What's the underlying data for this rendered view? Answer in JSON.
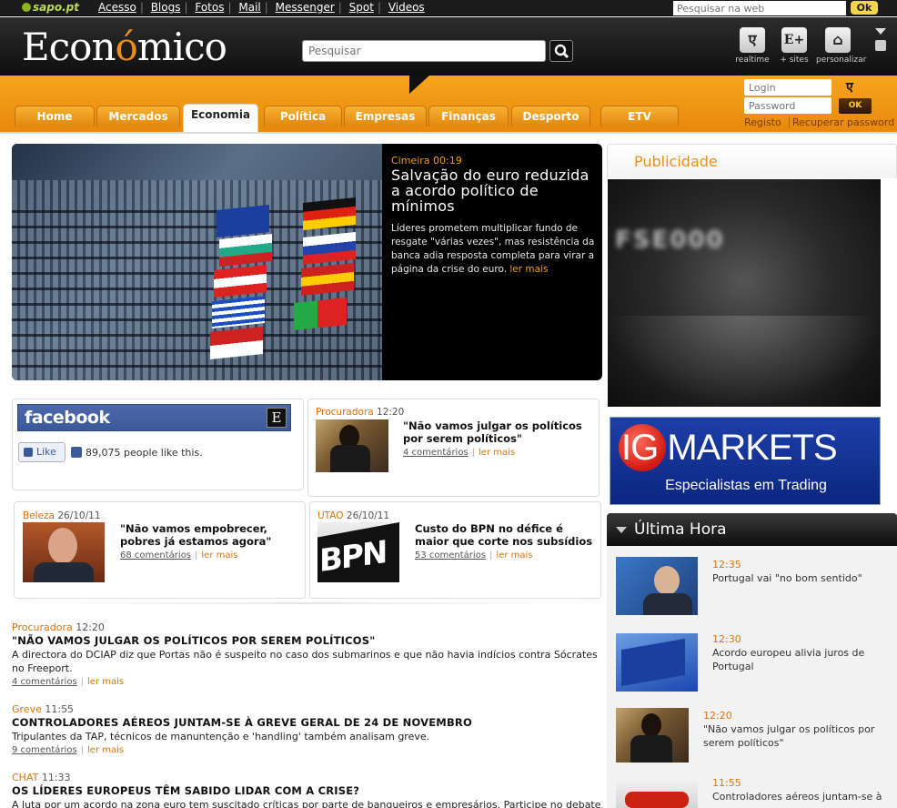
{
  "sapo": {
    "logo": "sapo.pt",
    "links": [
      "Acesso",
      "Blogs",
      "Fotos",
      "Mail",
      "Messenger",
      "Spot",
      "Videos"
    ],
    "search_placeholder": "Pesquisar na web",
    "ok_label": "Ok"
  },
  "header": {
    "logo_pre": "Econ",
    "logo_accent": "ó",
    "logo_post": "mico",
    "search_placeholder": "Pesquisar",
    "icons": [
      {
        "glyph": "ए",
        "label": "realtime"
      },
      {
        "glyph": "E+",
        "label": "+ sites"
      },
      {
        "glyph": "⌂",
        "label": "personalizar"
      }
    ]
  },
  "nav": {
    "tabs": [
      "Home",
      "Mercados",
      "Economia",
      "Política",
      "Empresas",
      "Finanças",
      "Desporto",
      "ETV"
    ],
    "active": "Economia"
  },
  "login": {
    "login_placeholder": "Login",
    "password_placeholder": "Password",
    "ok_label": "OK",
    "register": "Registo",
    "recover": "Recuperar password"
  },
  "hero": {
    "kicker": "Cimeira 00:19",
    "title": "Salvação do euro reduzida a acordo político de mínimos",
    "desc": "Líderes prometem multiplicar fundo de resgate \"várias vezes\", mas resistência da banca adia resposta completa para virar a página da crise do euro.",
    "more": "ler mais"
  },
  "facebook": {
    "brand": "facebook",
    "badge": "E",
    "like_label": "Like",
    "like_count": "89,075 people like this."
  },
  "cards": [
    {
      "section": "Procuradora",
      "time": "12:20",
      "title": "\"Não vamos julgar os políticos por serem políticos\"",
      "comments": "4 comentários",
      "more": "ler mais"
    },
    {
      "section": "Beleza",
      "time": "26/10/11",
      "title": "\"Não vamos empobrecer, pobres já estamos agora\"",
      "comments": "68 comentários",
      "more": "ler mais"
    },
    {
      "section": "UTAO",
      "time": "26/10/11",
      "title": "Custo do BPN no défice é maior que corte nos subsídios",
      "comments": "53 comentários",
      "more": "ler mais",
      "thumb_text": "BPN"
    }
  ],
  "articles": [
    {
      "section": "Procuradora",
      "time": "12:20",
      "title": "\"NÃO VAMOS JULGAR OS POLÍTICOS POR SEREM POLÍTICOS\"",
      "desc": "A directora do DCIAP diz que Portas não é suspeito no caso dos submarinos e que não havia indícios contra Sócrates no Freeport.",
      "comments": "4 comentários",
      "more": "ler mais"
    },
    {
      "section": "Greve",
      "time": "11:55",
      "title": "CONTROLADORES AÉREOS JUNTAM-SE À GREVE GERAL DE 24 DE NOVEMBRO",
      "desc": "Tripulantes da TAP, técnicos de manuntenção e 'handling' também analisam greve.",
      "comments": "9 comentários",
      "more": "ler mais"
    },
    {
      "section": "CHAT",
      "time": "11:33",
      "title": "OS LÍDERES EUROPEUS TÊM SABIDO LIDAR COM A CRISE?",
      "desc": "A luta por um acordo na zona euro tem suscitado críticas por parte de banqueiros e empresários. Participe no debate. A"
    }
  ],
  "publicidade": {
    "title": "Publicidade",
    "ad1_text": "FSE000",
    "ad2_brand": "IG MARKETS",
    "ad2_tagline": "Especialistas em Trading"
  },
  "ultima_hora": {
    "title": "Última Hora",
    "items": [
      {
        "time": "12:35",
        "text": "Portugal vai \"no bom sentido\""
      },
      {
        "time": "12:30",
        "text": "Acordo europeu alivia juros de Portugal"
      },
      {
        "time": "12:20",
        "text": "\"Não vamos julgar os políticos por serem políticos\""
      },
      {
        "time": "11:55",
        "text": "Controladores aéreos juntam-se à"
      }
    ]
  },
  "colors": {
    "orange": "#e8901a",
    "accent_text": "#d9730d",
    "facebook_blue": "#3b5998",
    "ig_blue": "#0b2680"
  }
}
